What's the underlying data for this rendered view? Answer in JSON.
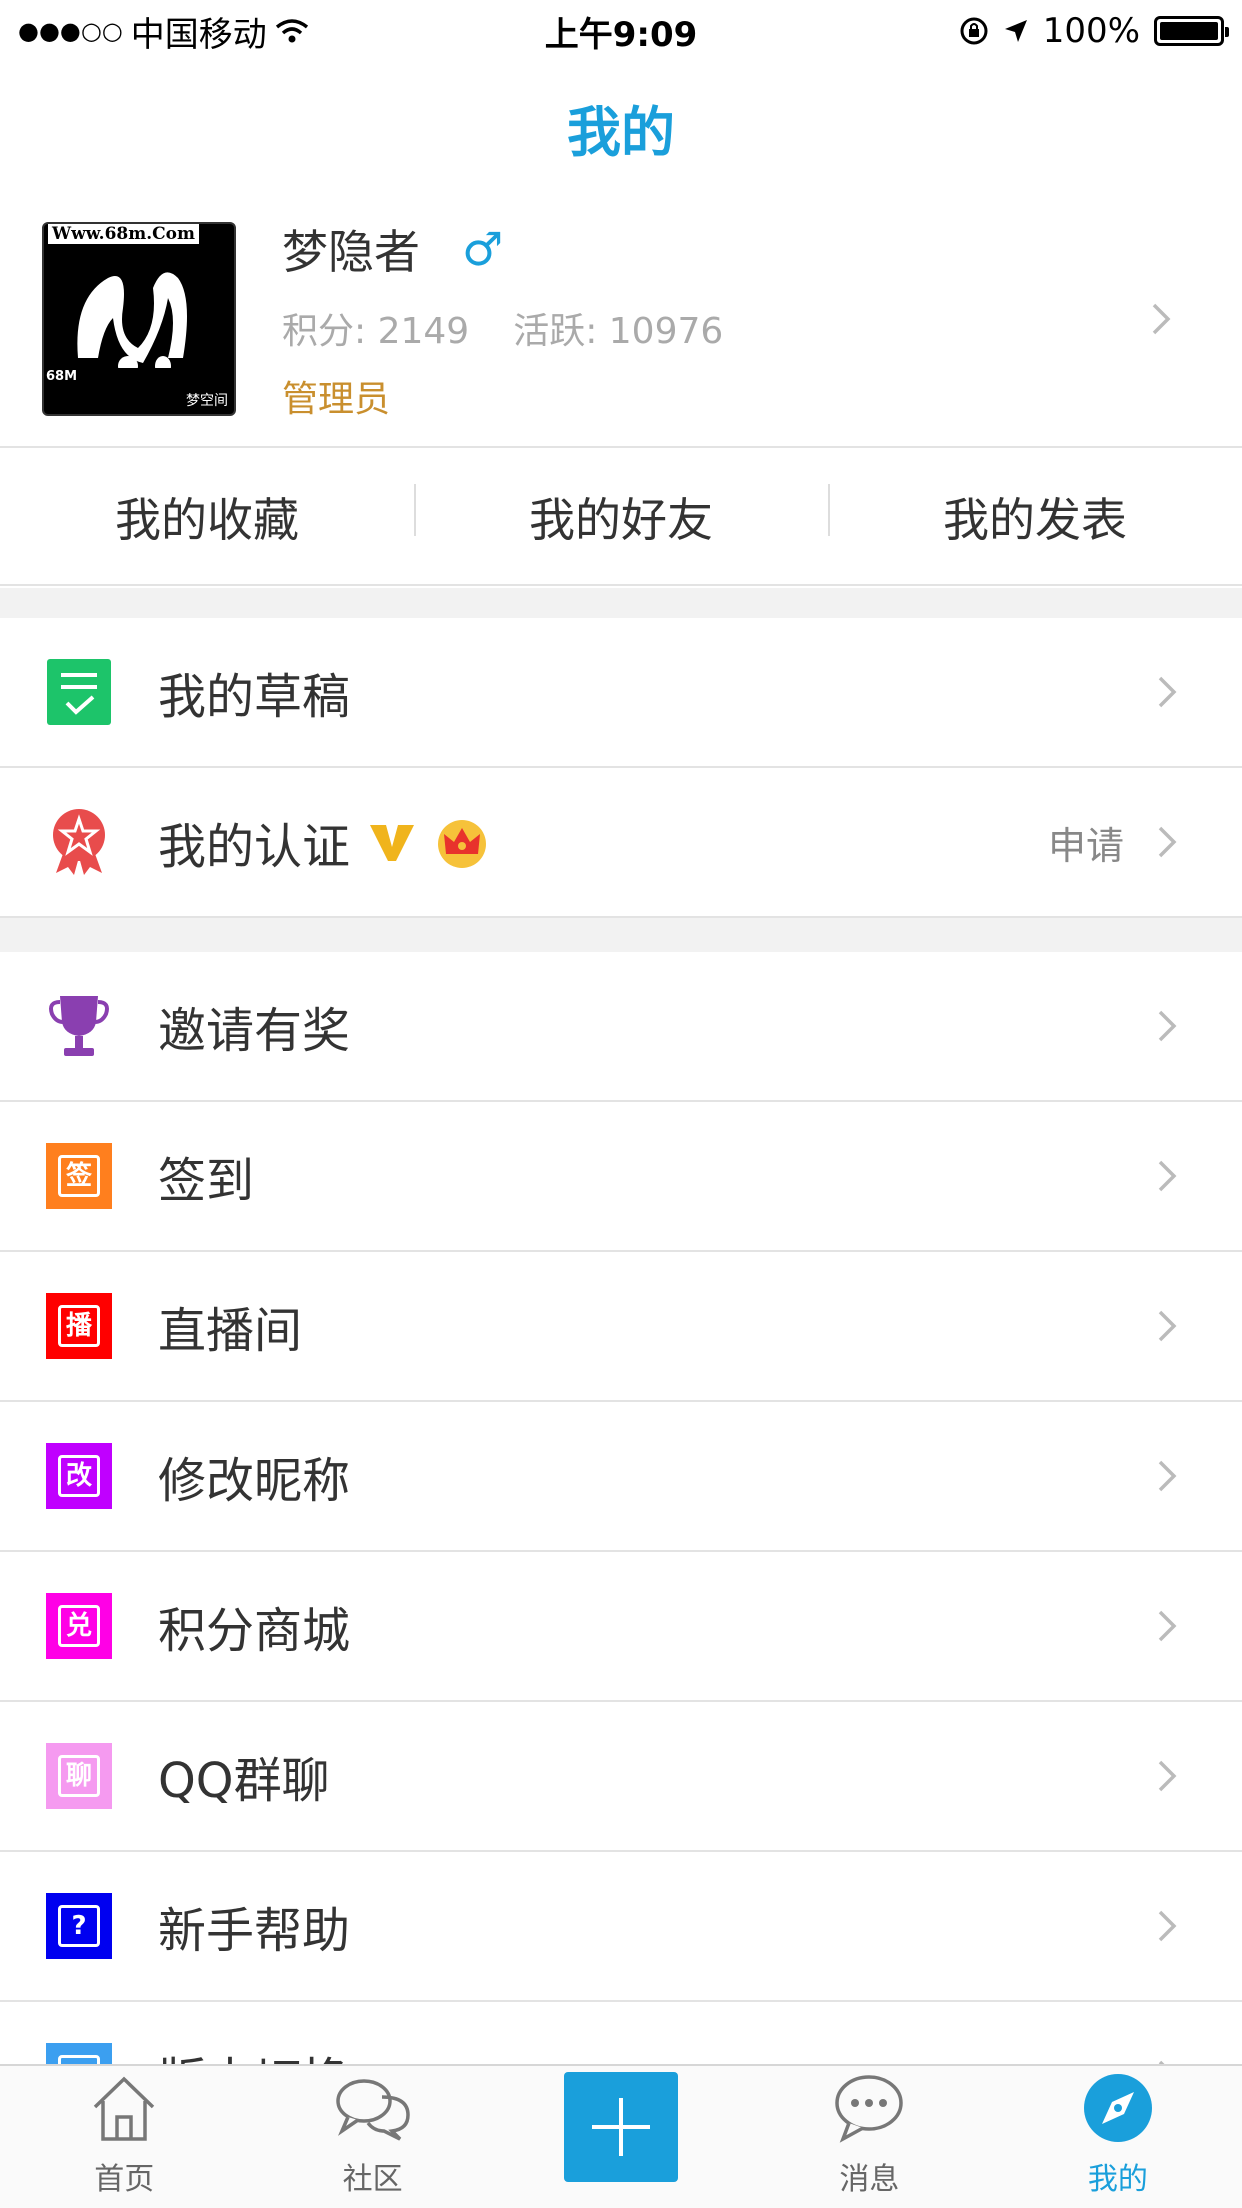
{
  "status_bar": {
    "signal": "●●●○○",
    "carrier": "中国移动",
    "time": "上午9:09",
    "battery": "100%"
  },
  "nav": {
    "title": "我的"
  },
  "profile": {
    "name": "梦隐者",
    "gender_symbol": "♂",
    "points": "积分: 2149",
    "activity": "活跃: 10976",
    "role": "管理员",
    "avatar_text_top": "Www.68m.Com",
    "avatar_text_bl": "68M",
    "avatar_text_br": "梦空间"
  },
  "quick_tabs": [
    "我的收藏",
    "我的好友",
    "我的发表"
  ],
  "section1": [
    {
      "label": "我的草稿",
      "icon": "draft-icon"
    },
    {
      "label": "我的认证",
      "icon": "certification-icon",
      "side": "申请"
    }
  ],
  "section2": [
    {
      "label": "邀请有奖",
      "icon": "trophy-icon"
    },
    {
      "label": "签到",
      "icon": "checkin-icon",
      "glyph": "签",
      "color": "#ff7f1e"
    },
    {
      "label": "直播间",
      "icon": "live-icon",
      "glyph": "播",
      "color": "#ff0000"
    },
    {
      "label": "修改昵称",
      "icon": "rename-icon",
      "glyph": "改",
      "color": "#c000ff"
    },
    {
      "label": "积分商城",
      "icon": "points-mall-icon",
      "glyph": "兑",
      "color": "#ff00e6"
    },
    {
      "label": "QQ群聊",
      "icon": "qq-group-icon",
      "glyph": "聊",
      "color": "#f59af0"
    },
    {
      "label": "新手帮助",
      "icon": "help-icon",
      "glyph": "?",
      "color": "#0000f0"
    },
    {
      "label": "版本切换",
      "icon": "version-icon",
      "glyph": "",
      "color": "#3b9ff0"
    }
  ],
  "tab_bar": [
    {
      "label": "首页",
      "icon": "home-icon"
    },
    {
      "label": "社区",
      "icon": "community-icon"
    },
    {
      "label": "",
      "icon": "plus-icon"
    },
    {
      "label": "消息",
      "icon": "message-icon"
    },
    {
      "label": "我的",
      "icon": "compass-icon",
      "active": true
    }
  ],
  "colors": {
    "accent": "#1a9fdb",
    "role": "#c98f2e"
  }
}
